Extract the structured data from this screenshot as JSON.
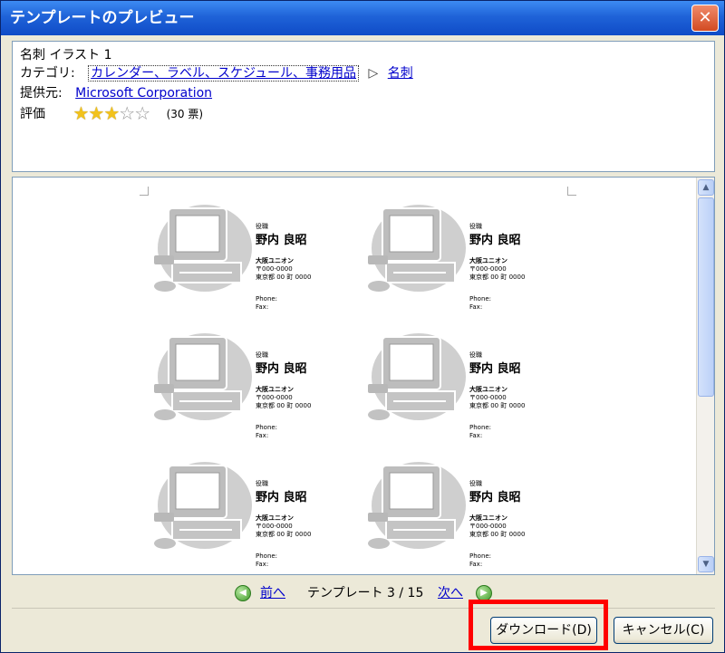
{
  "window": {
    "title": "テンプレートのプレビュー",
    "close_label": "✕"
  },
  "info": {
    "name": "名刺 イラスト 1",
    "category_label": "カテゴリ:",
    "category_link": "カレンダー、ラベル、スケジュール、事務用品",
    "category_sep": "▷",
    "category_sub": "名刺",
    "provider_label": "提供元:",
    "provider": "Microsoft Corporation",
    "rating_label": "評価",
    "rating_value": 3,
    "rating_max": 5,
    "votes": "(30 票)"
  },
  "card": {
    "title_small": "役職",
    "name": "野内 良昭",
    "company": "大阪ユニオン",
    "zip": "〒000-0000",
    "address": "東京都 00 町 0000",
    "phone": "Phone:",
    "fax": "Fax:"
  },
  "nav": {
    "prev_icon": "◀",
    "prev": "前へ",
    "count": "テンプレート 3 / 15",
    "next": "次へ",
    "next_icon": "▶"
  },
  "buttons": {
    "download": "ダウンロード(D)",
    "cancel": "キャンセル(C)"
  },
  "scroll": {
    "up": "▲",
    "down": "▼"
  }
}
